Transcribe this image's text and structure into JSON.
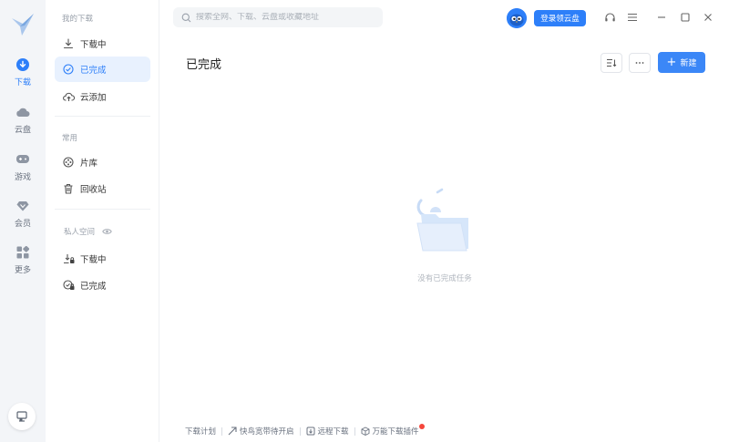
{
  "colors": {
    "accent": "#2d7ff9",
    "rail_bg": "#f3f5f8",
    "notice_dot": "#f5463b"
  },
  "rail": {
    "items": [
      {
        "label": "下载",
        "icon": "download-icon",
        "active": true
      },
      {
        "label": "云盘",
        "icon": "cloud-icon",
        "active": false
      },
      {
        "label": "游戏",
        "icon": "gamepad-icon",
        "active": false
      },
      {
        "label": "会员",
        "icon": "diamond-icon",
        "active": false
      },
      {
        "label": "更多",
        "icon": "grid-icon",
        "active": false
      }
    ]
  },
  "sidebar": {
    "my_downloads_title": "我的下载",
    "my_downloads": [
      {
        "label": "下载中",
        "icon": "download-arrow-icon"
      },
      {
        "label": "已完成",
        "icon": "check-circle-icon",
        "active": true
      },
      {
        "label": "云添加",
        "icon": "cloud-upload-icon"
      }
    ],
    "common_title": "常用",
    "common": [
      {
        "label": "片库",
        "icon": "film-reel-icon"
      },
      {
        "label": "回收站",
        "icon": "trash-icon"
      }
    ],
    "private_title": "私人空间",
    "private": [
      {
        "label": "下载中",
        "icon": "locked-download-icon"
      },
      {
        "label": "已完成",
        "icon": "locked-check-icon"
      }
    ]
  },
  "topbar": {
    "search_placeholder": "搜索全网、下载、云盘或收藏地址",
    "login_label": "登录领云盘"
  },
  "main": {
    "title": "已完成",
    "new_label": "新建",
    "empty_text": "没有已完成任务"
  },
  "footer": {
    "items": [
      "下载计划",
      "快鸟宽带待开启",
      "远程下载",
      "万能下载插件"
    ]
  }
}
